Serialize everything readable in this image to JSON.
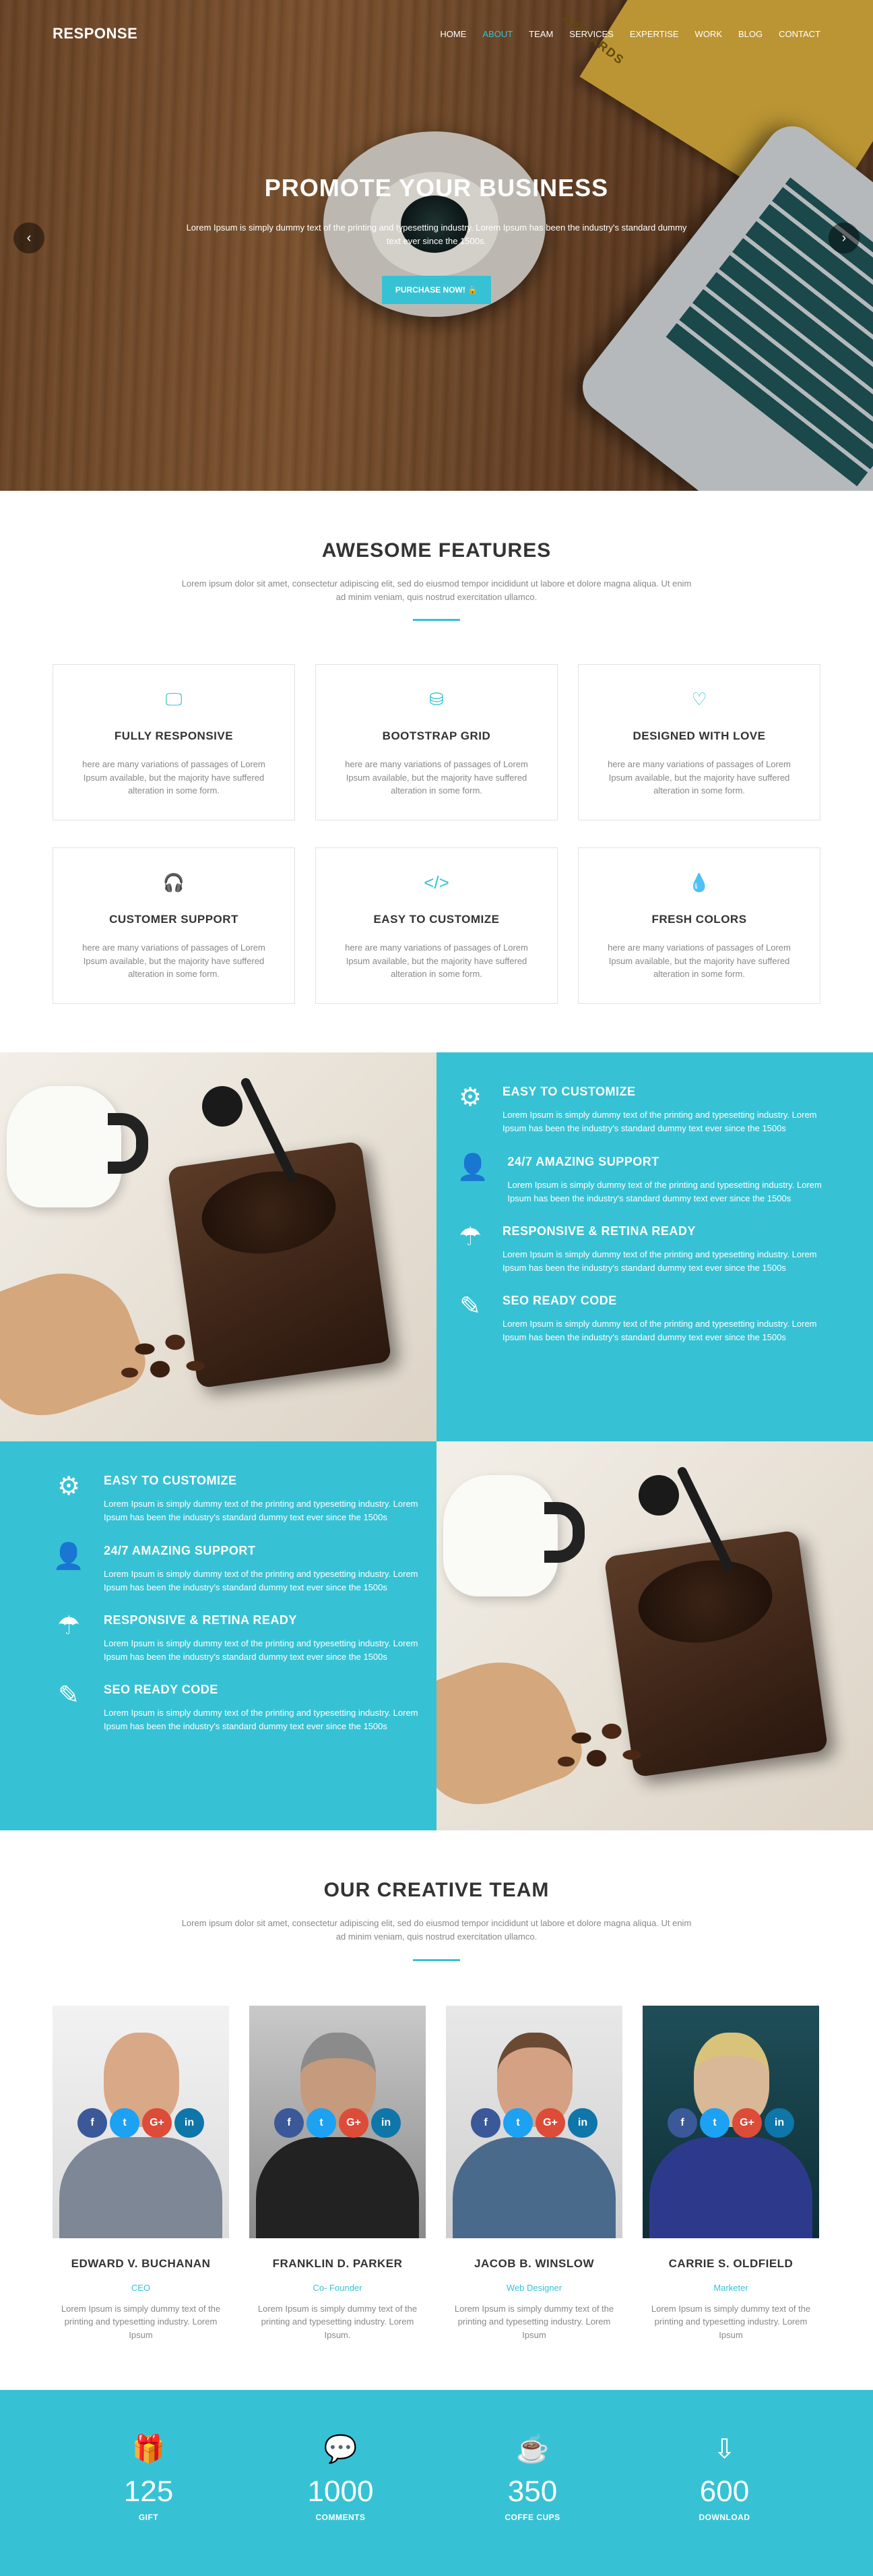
{
  "nav": {
    "logo": "RESPONSE",
    "items": [
      "HOME",
      "ABOUT",
      "TEAM",
      "SERVICES",
      "EXPERTISE",
      "WORK",
      "BLOG",
      "CONTACT"
    ]
  },
  "hero": {
    "title": "PROMOTE YOUR BUSINESS",
    "text": "Lorem Ipsum is simply dummy text of the printing and typesetting industry. Lorem Ipsum has been the industry's standard dummy text ever since the 1500s.",
    "button": "PURCHASE NOW! 🔒",
    "prev": "‹",
    "next": "›",
    "paper_text": "AWWARDS"
  },
  "features": {
    "title": "AWESOME FEATURES",
    "desc": "Lorem ipsum dolor sit amet, consectetur adipiscing elit, sed do eiusmod tempor incididunt ut labore et dolore magna aliqua. Ut enim ad minim veniam, quis nostrud exercitation ullamco.",
    "items": [
      {
        "icon": "🖵",
        "title": "FULLY RESPONSIVE",
        "text": "here are many variations of passages of Lorem Ipsum available, but the majority have suffered alteration in some form."
      },
      {
        "icon": "⛁",
        "title": "BOOTSTRAP GRID",
        "text": "here are many variations of passages of Lorem Ipsum available, but the majority have suffered alteration in some form."
      },
      {
        "icon": "♡",
        "title": "DESIGNED WITH LOVE",
        "text": "here are many variations of passages of Lorem Ipsum available, but the majority have suffered alteration in some form."
      },
      {
        "icon": "🎧",
        "title": "CUSTOMER SUPPORT",
        "text": "here are many variations of passages of Lorem Ipsum available, but the majority have suffered alteration in some form."
      },
      {
        "icon": "</>",
        "title": "EASY TO CUSTOMIZE",
        "text": "here are many variations of passages of Lorem Ipsum available, but the majority have suffered alteration in some form."
      },
      {
        "icon": "💧",
        "title": "FRESH COLORS",
        "text": "here are many variations of passages of Lorem Ipsum available, but the majority have suffered alteration in some form."
      }
    ]
  },
  "points": [
    {
      "icon": "⚙",
      "title": "EASY TO CUSTOMIZE",
      "text": "Lorem Ipsum is simply dummy text of the printing and typesetting industry. Lorem Ipsum has been the industry's standard dummy text ever since the 1500s"
    },
    {
      "icon": "👤",
      "title": "24/7 AMAZING SUPPORT",
      "text": "Lorem Ipsum is simply dummy text of the printing and typesetting industry. Lorem Ipsum has been the industry's standard dummy text ever since the 1500s"
    },
    {
      "icon": "☂",
      "title": "RESPONSIVE & RETINA READY",
      "text": "Lorem Ipsum is simply dummy text of the printing and typesetting industry. Lorem Ipsum has been the industry's standard dummy text ever since the 1500s"
    },
    {
      "icon": "✎",
      "title": "SEO READY CODE",
      "text": "Lorem Ipsum is simply dummy text of the printing and typesetting industry. Lorem Ipsum has been the industry's standard dummy text ever since the 1500s"
    }
  ],
  "team": {
    "title": "OUR CREATIVE TEAM",
    "desc": "Lorem ipsum dolor sit amet, consectetur adipiscing elit, sed do eiusmod tempor incididunt ut labore et dolore magna aliqua. Ut enim ad minim veniam, quis nostrud exercitation ullamco.",
    "socials": [
      "f",
      "t",
      "G+",
      "in"
    ],
    "members": [
      {
        "name": "EDWARD V. BUCHANAN",
        "role": "CEO",
        "text": "Lorem Ipsum is simply dummy text of the printing and typesetting industry. Lorem Ipsum"
      },
      {
        "name": "FRANKLIN D. PARKER",
        "role": "Co- Founder",
        "text": "Lorem Ipsum is simply dummy text of the printing and typesetting industry. Lorem Ipsum."
      },
      {
        "name": "JACOB B. WINSLOW",
        "role": "Web Designer",
        "text": "Lorem Ipsum is simply dummy text of the printing and typesetting industry. Lorem Ipsum"
      },
      {
        "name": "CARRIE S. OLDFIELD",
        "role": "Marketer",
        "text": "Lorem Ipsum is simply dummy text of the printing and typesetting industry. Lorem Ipsum"
      }
    ]
  },
  "stats": [
    {
      "icon": "🎁",
      "number": "125",
      "label": "GIFT"
    },
    {
      "icon": "💬",
      "number": "1000",
      "label": "COMMENTS"
    },
    {
      "icon": "☕",
      "number": "350",
      "label": "COFFE CUPS"
    },
    {
      "icon": "⇩",
      "number": "600",
      "label": "DOWNLOAD"
    }
  ],
  "colors": {
    "accent": "#36c2d4"
  }
}
